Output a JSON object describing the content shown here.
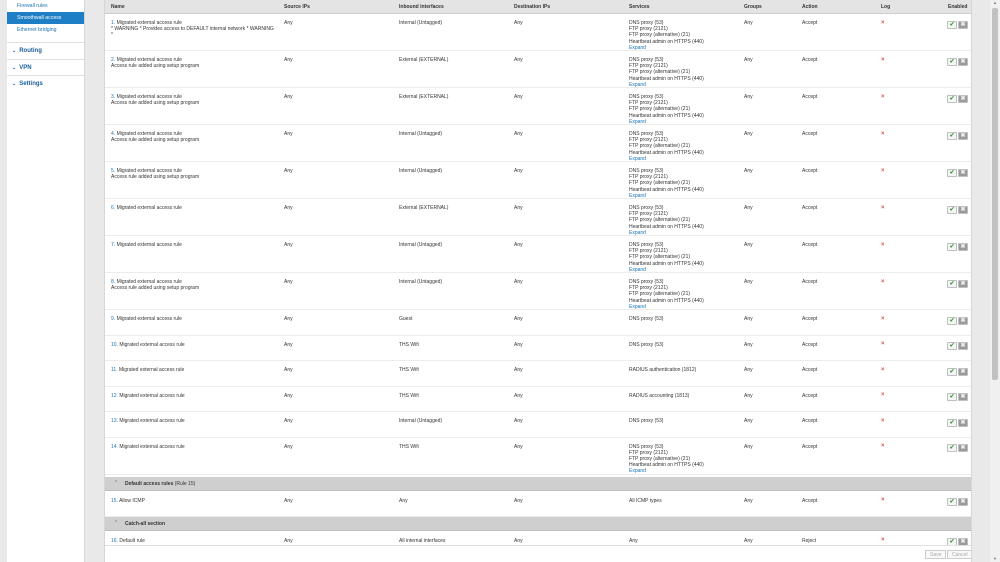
{
  "sidebar": {
    "sub_items": [
      {
        "label": "Firewall rules",
        "active": false
      },
      {
        "label": "Smoothwall access",
        "active": true
      },
      {
        "label": "Ethernet bridging",
        "active": false
      }
    ],
    "nav_items": [
      {
        "label": "Routing"
      },
      {
        "label": "VPN"
      },
      {
        "label": "Settings"
      }
    ]
  },
  "table": {
    "headers": {
      "name": "Name",
      "source": "Source IPs",
      "inbound": "Inbound interfaces",
      "dest": "Destination IPs",
      "services": "Services",
      "groups": "Groups",
      "action": "Action",
      "log": "Log",
      "enabled": "Enabled"
    },
    "expand_label": "Expand",
    "log_symbol": "×",
    "enable_symbol": "✔",
    "disable_symbol": "✖",
    "rows": [
      {
        "num": "1.",
        "name": "Migrated external access rule",
        "desc": "* WARNING * Provides access to DEFAULT internal network * WARNING *",
        "source": "Any",
        "inbound": "Internal (Untagged)",
        "dest": "Any",
        "services": [
          "DNS proxy (53)",
          "FTP proxy (2121)",
          "FTP proxy (alternative) (21)",
          "Heartbeat admin on HTTPS (440)"
        ],
        "expand": true,
        "groups": "Any",
        "action": "Accept"
      },
      {
        "num": "2.",
        "name": "Migrated external access rule",
        "desc": "Access rule added using setup program",
        "source": "Any",
        "inbound": "External (EXTERNAL)",
        "dest": "Any",
        "services": [
          "DNS proxy (53)",
          "FTP proxy (2121)",
          "FTP proxy (alternative) (21)",
          "Heartbeat admin on HTTPS (440)"
        ],
        "expand": true,
        "groups": "Any",
        "action": "Accept"
      },
      {
        "num": "3.",
        "name": "Migrated external access rule",
        "desc": "Access rule added using setup program",
        "source": "Any",
        "inbound": "External (EXTERNAL)",
        "dest": "Any",
        "services": [
          "DNS proxy (53)",
          "FTP proxy (2121)",
          "FTP proxy (alternative) (21)",
          "Heartbeat admin on HTTPS (440)"
        ],
        "expand": true,
        "groups": "Any",
        "action": "Accept"
      },
      {
        "num": "4.",
        "name": "Migrated external access rule",
        "desc": "Access rule added using setup program",
        "source": "Any",
        "inbound": "Internal (Untagged)",
        "dest": "Any",
        "services": [
          "DNS proxy (53)",
          "FTP proxy (2121)",
          "FTP proxy (alternative) (21)",
          "Heartbeat admin on HTTPS (440)"
        ],
        "expand": true,
        "groups": "Any",
        "action": "Accept"
      },
      {
        "num": "5.",
        "name": "Migrated external access rule",
        "desc": "Access rule added using setup program",
        "source": "Any",
        "inbound": "Internal (Untagged)",
        "dest": "Any",
        "services": [
          "DNS proxy (53)",
          "FTP proxy (2121)",
          "FTP proxy (alternative) (21)",
          "Heartbeat admin on HTTPS (440)"
        ],
        "expand": true,
        "groups": "Any",
        "action": "Accept"
      },
      {
        "num": "6.",
        "name": "Migrated external access rule",
        "desc": "",
        "source": "Any",
        "inbound": "External (EXTERNAL)",
        "dest": "Any",
        "services": [
          "DNS proxy (53)",
          "FTP proxy (2121)",
          "FTP proxy (alternative) (21)",
          "Heartbeat admin on HTTPS (440)"
        ],
        "expand": true,
        "groups": "Any",
        "action": "Accept"
      },
      {
        "num": "7.",
        "name": "Migrated external access rule",
        "desc": "",
        "source": "Any",
        "inbound": "Internal (Untagged)",
        "dest": "Any",
        "services": [
          "DNS proxy (53)",
          "FTP proxy (2121)",
          "FTP proxy (alternative) (21)",
          "Heartbeat admin on HTTPS (440)"
        ],
        "expand": true,
        "groups": "Any",
        "action": "Accept"
      },
      {
        "num": "8.",
        "name": "Migrated external access rule",
        "desc": "Access rule added using setup program",
        "source": "Any",
        "inbound": "Internal (Untagged)",
        "dest": "Any",
        "services": [
          "DNS proxy (53)",
          "FTP proxy (2121)",
          "FTP proxy (alternative) (21)",
          "Heartbeat admin on HTTPS (440)"
        ],
        "expand": true,
        "groups": "Any",
        "action": "Accept"
      },
      {
        "num": "9.",
        "name": "Migrated external access rule",
        "desc": "",
        "source": "Any",
        "inbound": "Guest",
        "dest": "Any",
        "services": [
          "DNS proxy (53)"
        ],
        "expand": false,
        "groups": "Any",
        "action": "Accept"
      },
      {
        "num": "10.",
        "name": "Migrated external access rule",
        "desc": "",
        "source": "Any",
        "inbound": "THS Wifi",
        "dest": "Any",
        "services": [
          "DNS proxy (53)"
        ],
        "expand": false,
        "groups": "Any",
        "action": "Accept"
      },
      {
        "num": "11.",
        "name": "Migrated external access rule",
        "desc": "",
        "source": "Any",
        "inbound": "THS Wifi",
        "dest": "Any",
        "services": [
          "RADIUS authentication (1812)"
        ],
        "expand": false,
        "groups": "Any",
        "action": "Accept"
      },
      {
        "num": "12.",
        "name": "Migrated external access rule",
        "desc": "",
        "source": "Any",
        "inbound": "THS Wifi",
        "dest": "Any",
        "services": [
          "RADIUS accounting (1813)"
        ],
        "expand": false,
        "groups": "Any",
        "action": "Accept"
      },
      {
        "num": "13.",
        "name": "Migrated external access rule",
        "desc": "",
        "source": "Any",
        "inbound": "Internal (Untagged)",
        "dest": "Any",
        "services": [
          "DNS proxy (53)"
        ],
        "expand": false,
        "groups": "Any",
        "action": "Accept"
      },
      {
        "num": "14.",
        "name": "Migrated external access rule",
        "desc": "",
        "source": "Any",
        "inbound": "THS Wifi",
        "dest": "Any",
        "services": [
          "DNS proxy (53)",
          "FTP proxy (2121)",
          "FTP proxy (alternative) (21)",
          "Heartbeat admin on HTTPS (440)"
        ],
        "expand": true,
        "groups": "Any",
        "action": "Accept"
      }
    ],
    "default_section": {
      "title": "Default access rules",
      "note": "(Rule 15)"
    },
    "default_row": {
      "num": "15.",
      "name": "Allow ICMP",
      "desc": "",
      "source": "Any",
      "inbound": "Any",
      "dest": "Any",
      "services": [
        "All ICMP types"
      ],
      "expand": false,
      "groups": "Any",
      "action": "Accept"
    },
    "catchall_section": {
      "title": "Catch-all section"
    },
    "catchall_row": {
      "num": "16.",
      "name": "Default rule",
      "desc": "",
      "source": "Any",
      "inbound": "All internal interfaces",
      "dest": "Any",
      "services": [
        "Any"
      ],
      "expand": false,
      "groups": "Any",
      "action": "Reject"
    }
  },
  "footer": {
    "save_label": "Save",
    "cancel_label": "Cancel"
  },
  "colors": {
    "accent": "#1e7fc6",
    "link": "#1a73b8",
    "log_off": "#d9534f",
    "enabled": "#3c9a3c"
  }
}
